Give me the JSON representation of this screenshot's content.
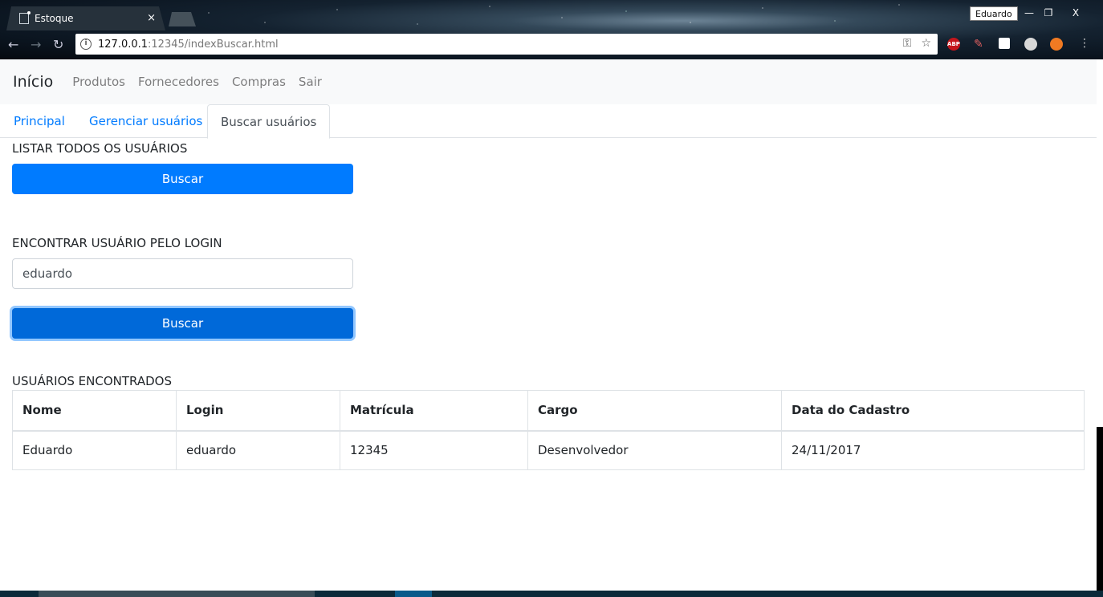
{
  "browser": {
    "tab_title": "Estoque",
    "tab_close": "×",
    "profile_name": "Eduardo",
    "window_buttons": [
      "minimize-icon",
      "restore-icon",
      "close-icon"
    ],
    "window_button_glyphs": [
      "—",
      "❐",
      "X"
    ],
    "url_host": "127.0.0.1",
    "url_rest": ":12345/indexBuscar.html",
    "nav_icons": [
      "back-arrow-icon",
      "forward-arrow-icon",
      "reload-icon"
    ],
    "omnibox_icons": [
      "key-icon",
      "star-icon"
    ],
    "extensions": [
      {
        "name": "abp-extension-icon",
        "color": "#c4161c",
        "label": "ABP"
      },
      {
        "name": "pen-extension-icon",
        "color": "#d9534f",
        "label": ""
      },
      {
        "name": "note-extension-icon",
        "color": "#ffffff",
        "label": ""
      },
      {
        "name": "circle-extension-icon",
        "color": "#cccccc",
        "label": ""
      },
      {
        "name": "orange-extension-icon",
        "color": "#f07a22",
        "label": ""
      }
    ],
    "menu_icon": "more-vert-icon"
  },
  "navbar": {
    "brand": "Início",
    "links": [
      "Produtos",
      "Fornecedores",
      "Compras",
      "Sair"
    ]
  },
  "tabs": {
    "items": [
      "Principal",
      "Gerenciar usuários",
      "Buscar usuários"
    ],
    "active": "Buscar usuários"
  },
  "list_all": {
    "label": "LISTAR TODOS OS USUÁRIOS",
    "button": "Buscar"
  },
  "find_login": {
    "label": "ENCONTRAR USUÁRIO PELO LOGIN",
    "input_value": "eduardo",
    "button": "Buscar"
  },
  "results": {
    "label": "USUÁRIOS ENCONTRADOS",
    "columns": [
      "Nome",
      "Login",
      "Matrícula",
      "Cargo",
      "Data do Cadastro"
    ],
    "rows": [
      [
        "Eduardo",
        "eduardo",
        "12345",
        "Desenvolvedor",
        "24/11/2017"
      ]
    ]
  },
  "colors": {
    "primary": "#007bff",
    "primary_focus": "#0069d9",
    "navbar_bg": "#f8f9fa",
    "muted_link": "rgba(0,0,0,.5)",
    "border": "#dee2e6"
  }
}
